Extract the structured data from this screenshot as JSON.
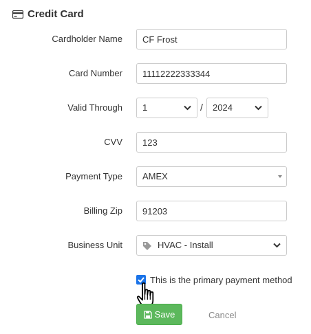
{
  "header": {
    "icon": "credit-card-icon",
    "title": "Credit Card"
  },
  "form": {
    "cardholder_name": {
      "label": "Cardholder Name",
      "value": "CF Frost"
    },
    "card_number": {
      "label": "Card Number",
      "value": "11112222333344"
    },
    "valid_through": {
      "label": "Valid Through",
      "month": "1",
      "separator": "/",
      "year": "2024"
    },
    "cvv": {
      "label": "CVV",
      "value": "123"
    },
    "payment_type": {
      "label": "Payment Type",
      "value": "AMEX"
    },
    "billing_zip": {
      "label": "Billing Zip",
      "value": "91203"
    },
    "business_unit": {
      "label": "Business Unit",
      "value": "HVAC - Install",
      "icon": "tag-icon"
    },
    "primary": {
      "label": "This is the primary payment method",
      "checked": true
    }
  },
  "actions": {
    "save_label": "Save",
    "cancel_label": "Cancel"
  },
  "colors": {
    "save_green": "#5cb85c",
    "checkbox_blue": "#1a73e8",
    "border": "#cccccc"
  }
}
